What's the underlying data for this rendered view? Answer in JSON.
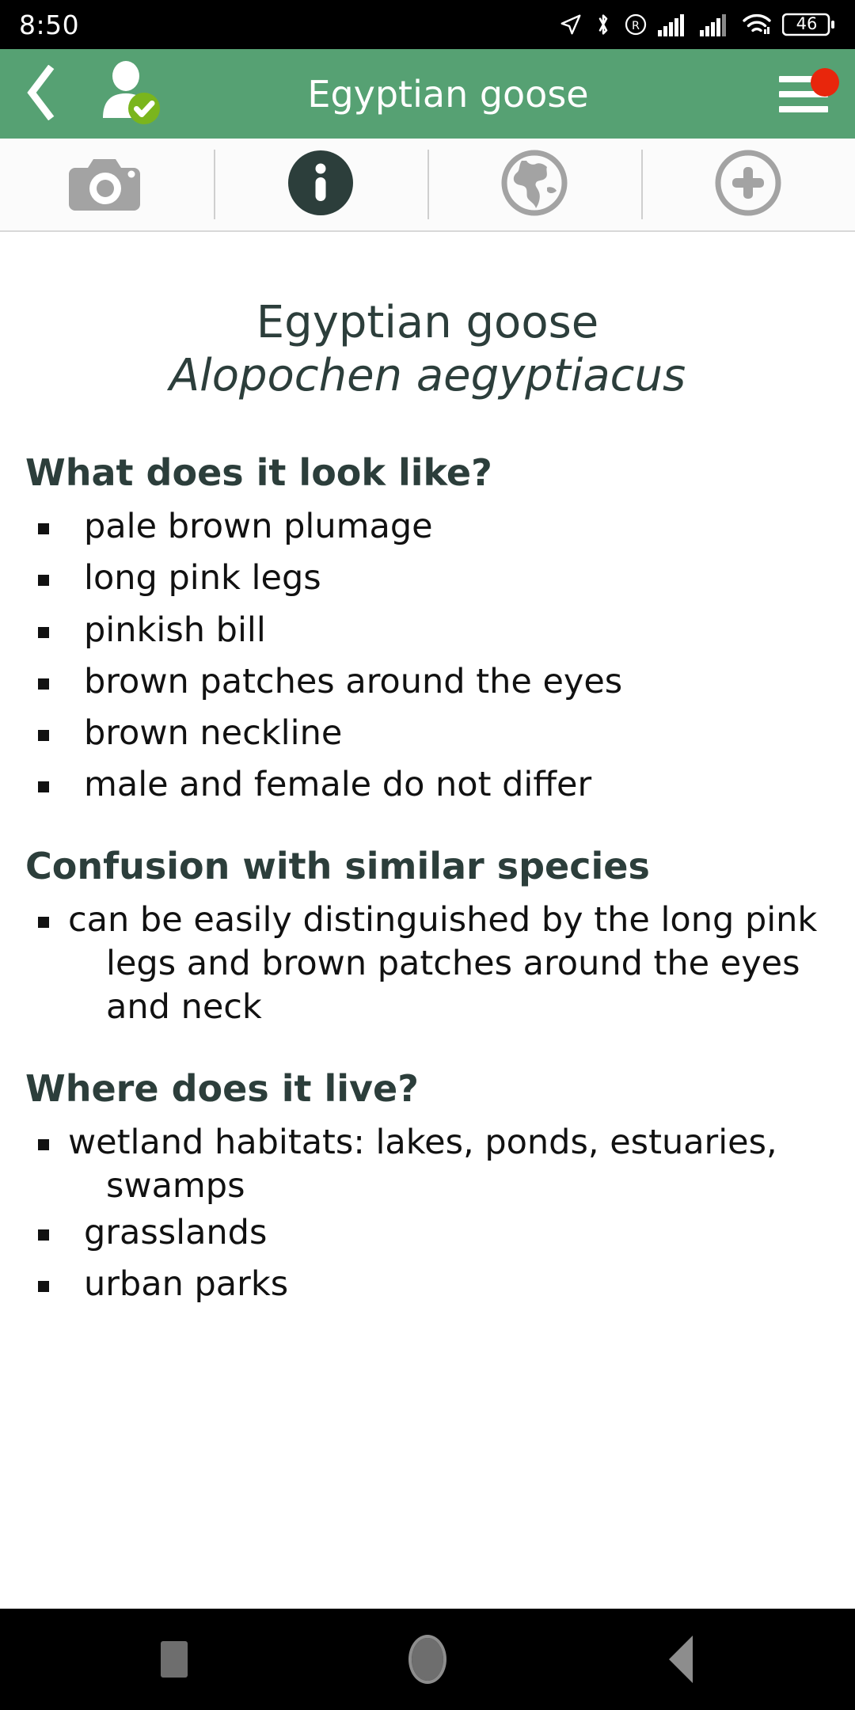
{
  "status_bar": {
    "time": "8:50",
    "battery_percent": "46",
    "icons": [
      "location-arrow-icon",
      "bluetooth-icon",
      "registered-r-icon",
      "signal-bars-sim1-icon",
      "signal-bars-sim2-icon",
      "wifi-icon",
      "battery-icon"
    ]
  },
  "app_bar": {
    "title": "Egyptian goose",
    "back_icon": "back-chevron-icon",
    "avatar_icon": "user-verified-icon",
    "menu_icon": "hamburger-menu-icon",
    "badge_visible": true,
    "background_color": "#56a173",
    "badge_color": "#e8260c",
    "verified_color": "#7ab51d"
  },
  "tab_bar": {
    "tabs": [
      {
        "name": "camera",
        "icon": "camera-icon",
        "active": false
      },
      {
        "name": "info",
        "icon": "info-icon",
        "active": true
      },
      {
        "name": "distribution",
        "icon": "globe-icon",
        "active": false
      },
      {
        "name": "add",
        "icon": "plus-circle-icon",
        "active": false
      }
    ],
    "active_color": "#2c3e3b",
    "inactive_color": "#a3a3a3"
  },
  "species": {
    "common_name": "Egyptian goose",
    "scientific_name": "Alopochen aegyptiacus"
  },
  "sections": [
    {
      "heading": "What does it look like?",
      "items": [
        "pale brown plumage",
        "long pink legs",
        "pinkish bill",
        "brown patches around the eyes",
        "brown neckline",
        "male and female do not differ"
      ]
    },
    {
      "heading": "Confusion with similar species",
      "items": [
        "can be easily distinguished by the long pink legs and brown patches around the eyes and neck"
      ]
    },
    {
      "heading": "Where does it live?",
      "items": [
        "wetland habitats: lakes, ponds, estuaries, swamps",
        "grasslands",
        "urban parks"
      ]
    }
  ],
  "nav_bar": {
    "buttons": [
      "recents-square-icon",
      "home-circle-icon",
      "back-triangle-icon"
    ]
  },
  "colors": {
    "header_green": "#56a173",
    "heading_slate": "#2c3e3b",
    "body_black": "#111111",
    "icon_gray": "#a3a3a3"
  }
}
